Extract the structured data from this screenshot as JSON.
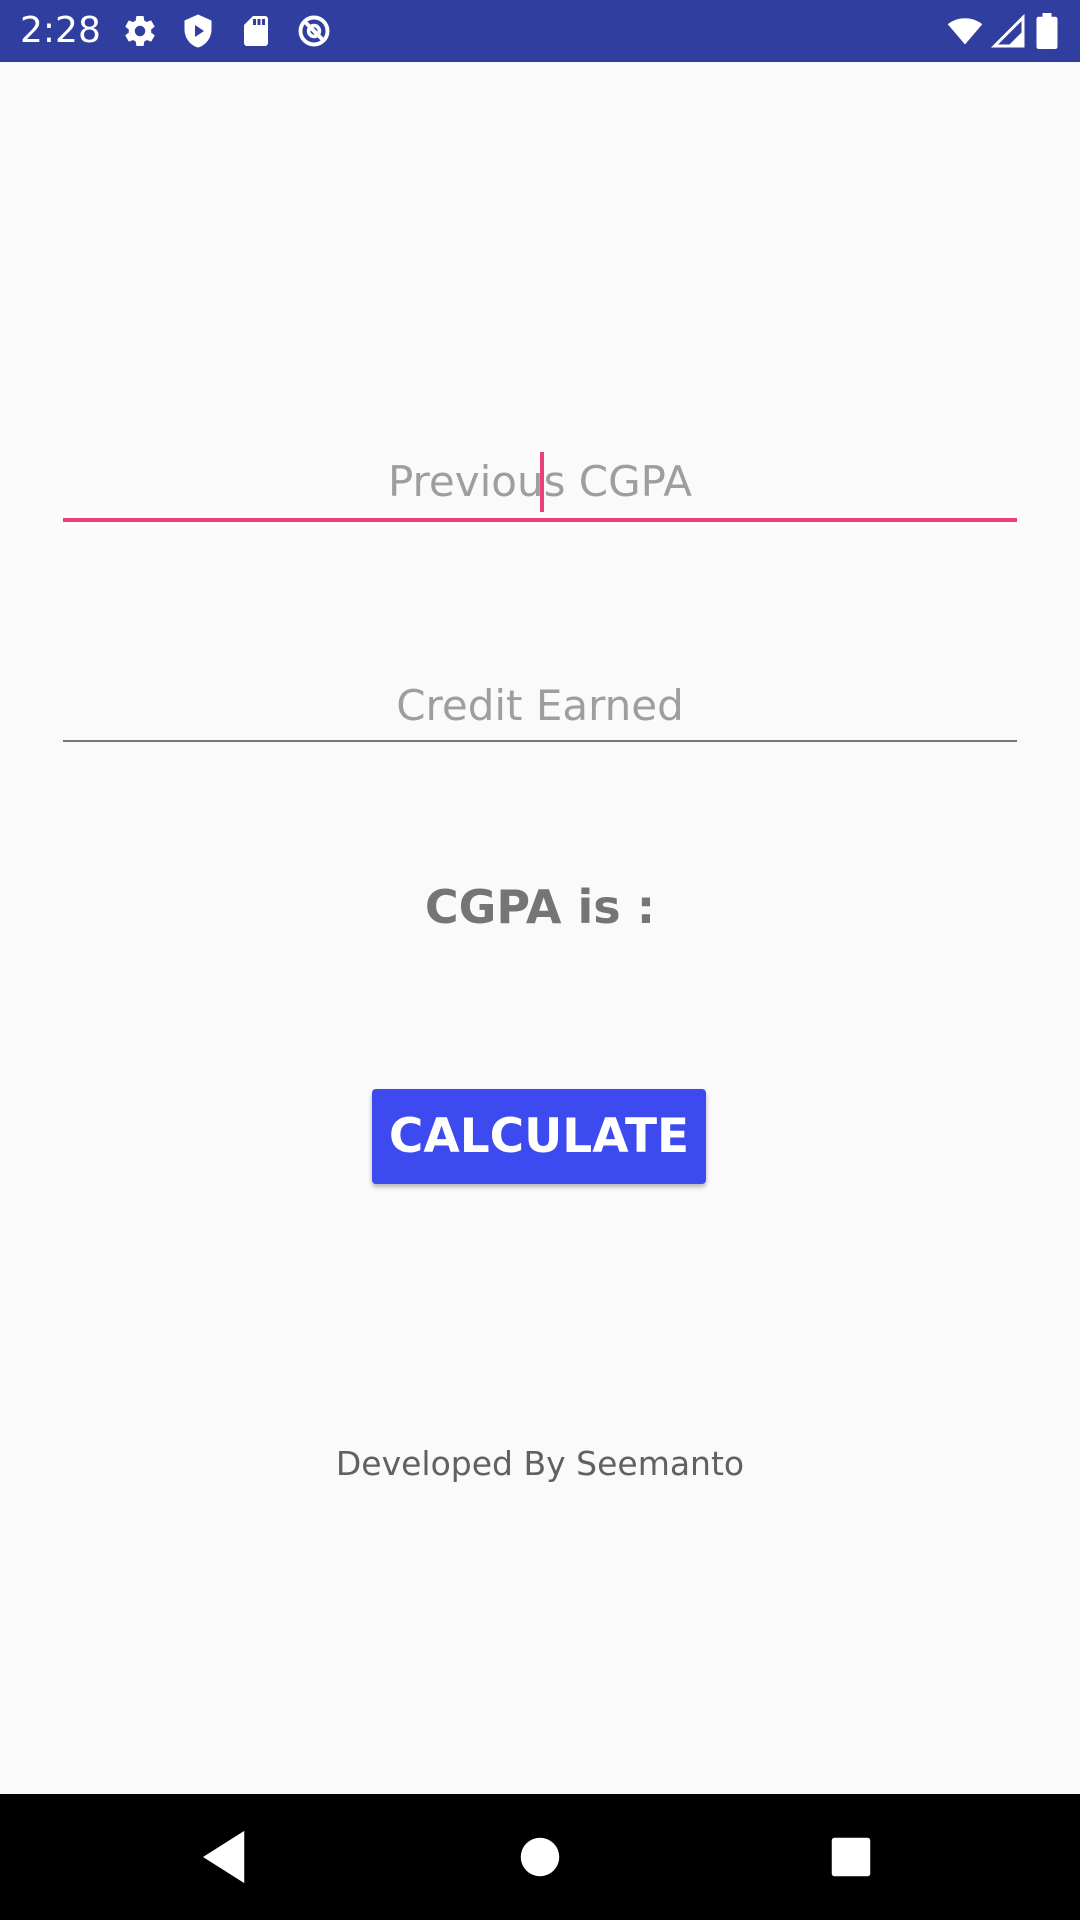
{
  "status_bar": {
    "time": "2:28",
    "background_color": "#303F9F",
    "left_icons": [
      "settings-gear-icon",
      "shield-icon",
      "sd-card-icon",
      "data-saver-icon"
    ],
    "right_icons": [
      "wifi-icon",
      "cellular-signal-icon",
      "battery-icon"
    ]
  },
  "form": {
    "previous_cgpa": {
      "placeholder": "Previous CGPA",
      "value": "",
      "focused": true,
      "accent_color": "#EC407A"
    },
    "credit_earned": {
      "placeholder": "Credit Earned",
      "value": ""
    }
  },
  "result": {
    "label": "CGPA is :"
  },
  "button": {
    "label": "CALCULATE",
    "color": "#3D4AF0"
  },
  "footer": {
    "credit": "Developed By Seemanto"
  },
  "nav_bar": {
    "buttons": [
      "back-icon",
      "home-icon",
      "recents-icon"
    ]
  }
}
